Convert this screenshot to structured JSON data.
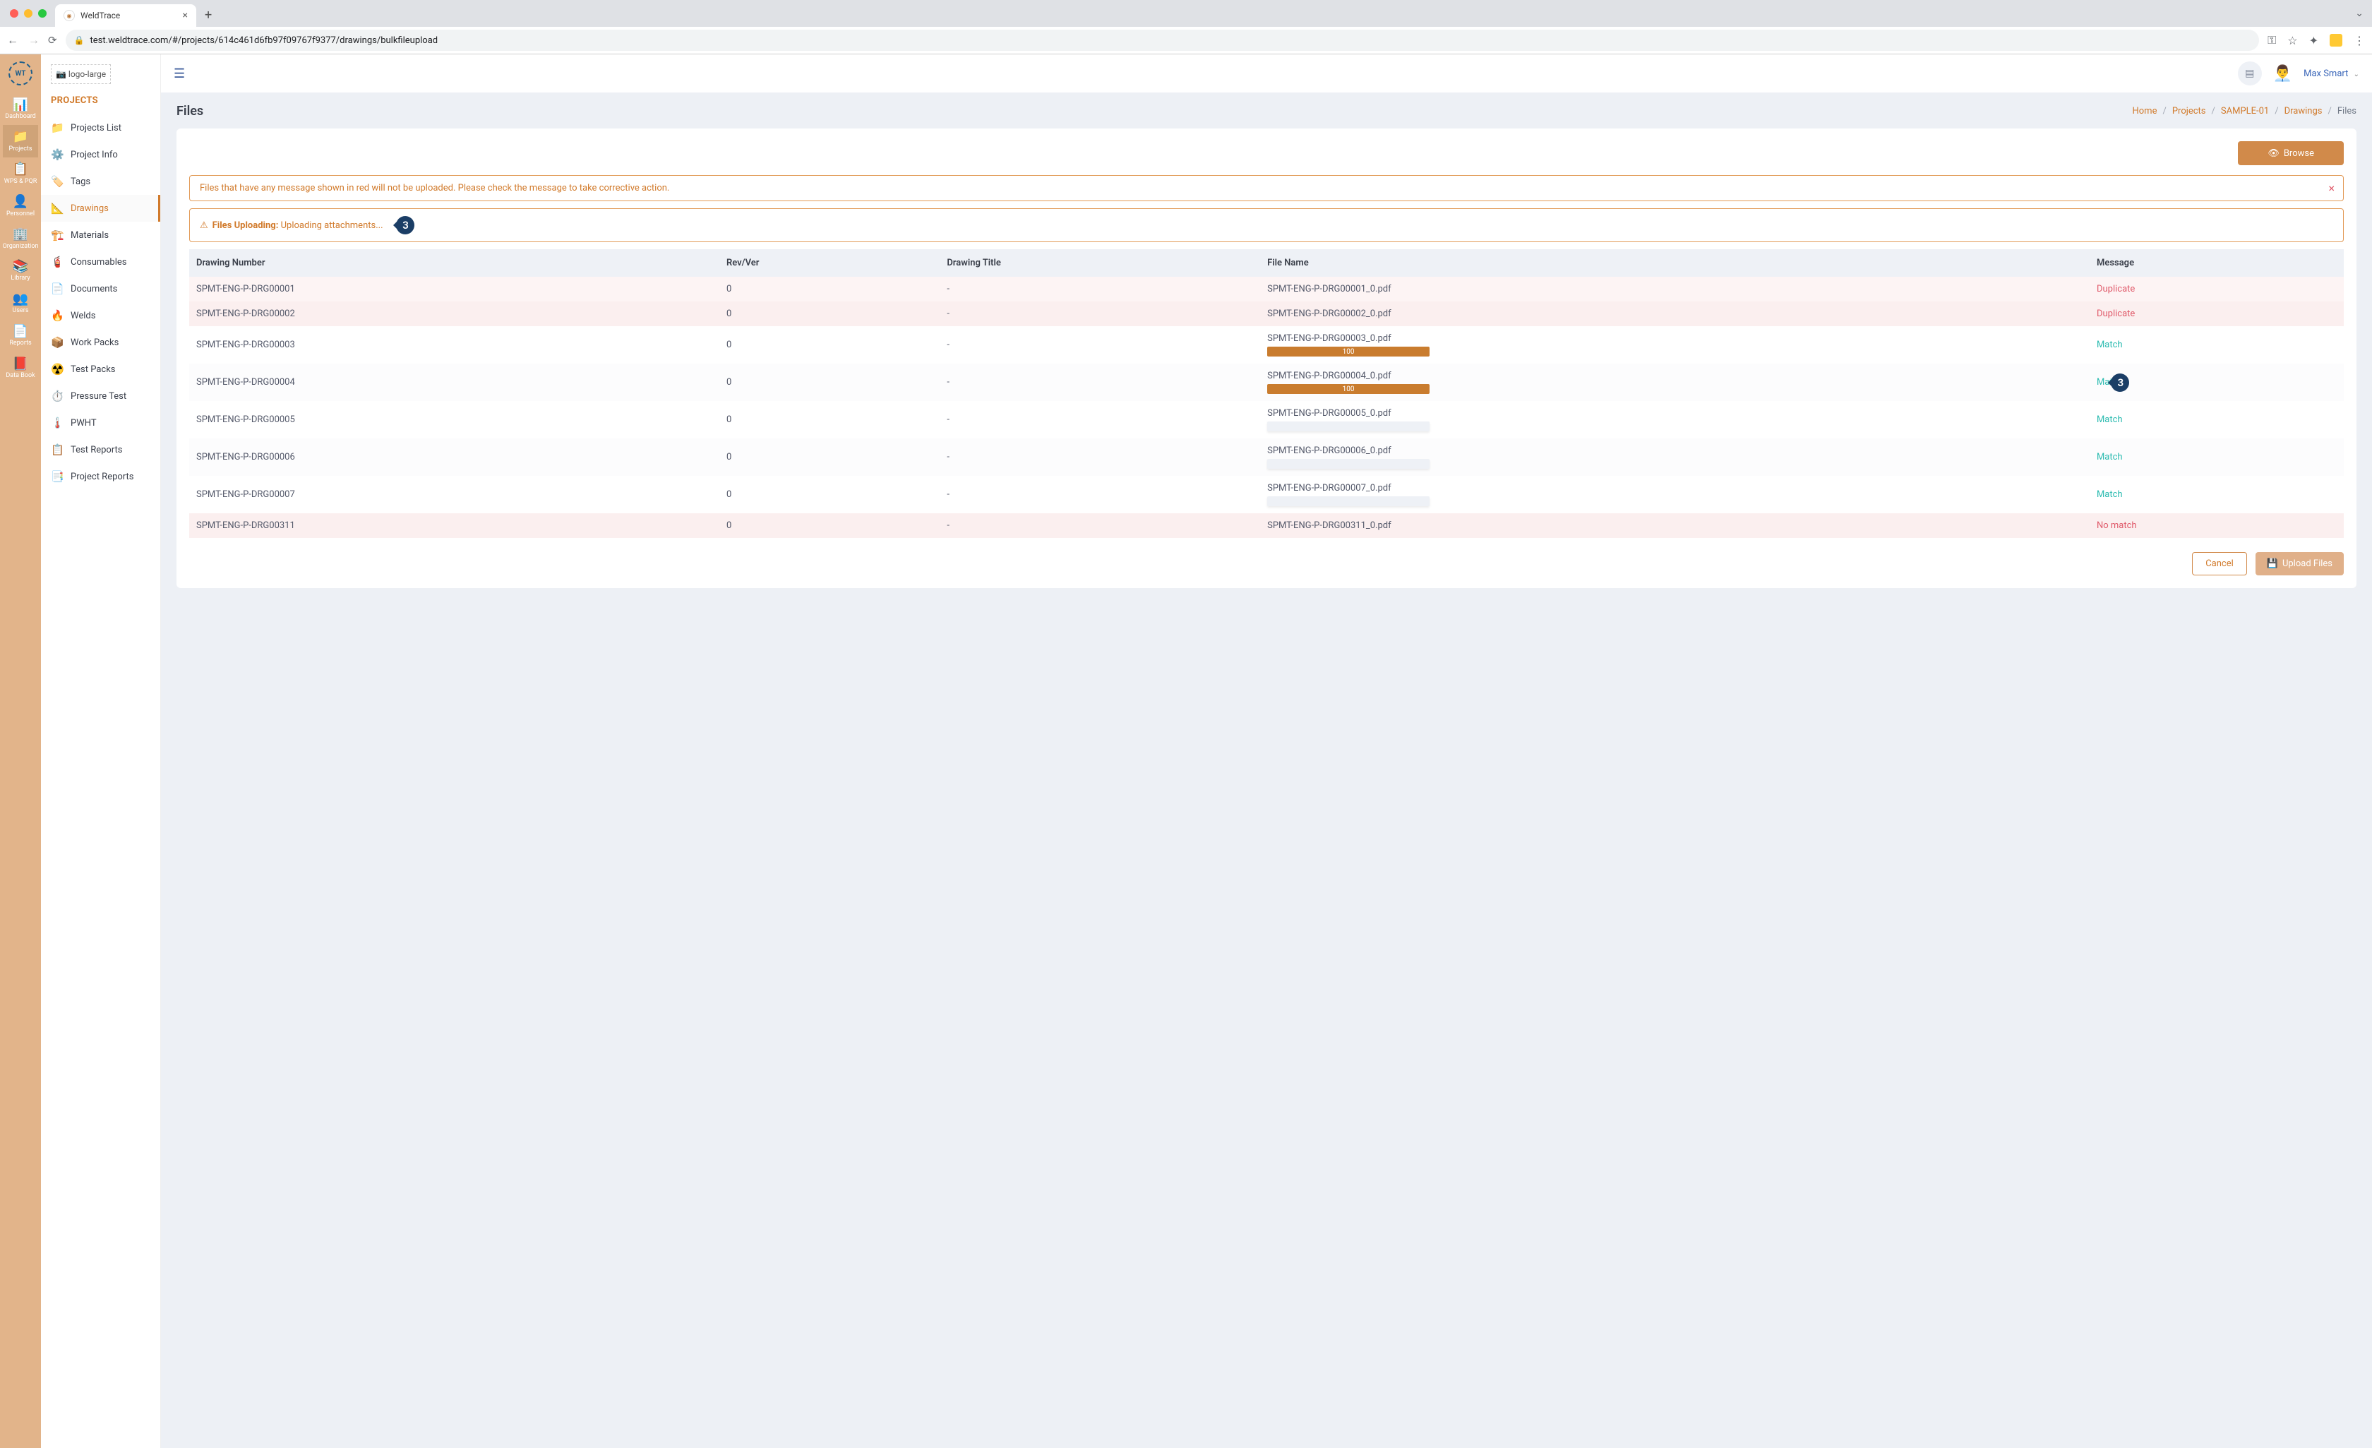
{
  "browser": {
    "tab_title": "WeldTrace",
    "url": "test.weldtrace.com/#/projects/614c461d6fb97f09767f9377/drawings/bulkfileupload"
  },
  "rail": {
    "items": [
      {
        "label": "Dashboard",
        "icon": "📊"
      },
      {
        "label": "Projects",
        "icon": "📁"
      },
      {
        "label": "WPS & PQR",
        "icon": "📋"
      },
      {
        "label": "Personnel",
        "icon": "👤"
      },
      {
        "label": "Organization",
        "icon": "🏢"
      },
      {
        "label": "Library",
        "icon": "📚"
      },
      {
        "label": "Users",
        "icon": "👥"
      },
      {
        "label": "Reports",
        "icon": "📄"
      },
      {
        "label": "Data Book",
        "icon": "📕"
      }
    ]
  },
  "submenu": {
    "logo_alt": "logo-large",
    "heading": "PROJECTS",
    "items": [
      {
        "label": "Projects List",
        "icon": "📁"
      },
      {
        "label": "Project Info",
        "icon": "⚙️"
      },
      {
        "label": "Tags",
        "icon": "🏷️"
      },
      {
        "label": "Drawings",
        "icon": "📐"
      },
      {
        "label": "Materials",
        "icon": "🏗️"
      },
      {
        "label": "Consumables",
        "icon": "🧯"
      },
      {
        "label": "Documents",
        "icon": "📄"
      },
      {
        "label": "Welds",
        "icon": "🔥"
      },
      {
        "label": "Work Packs",
        "icon": "📦"
      },
      {
        "label": "Test Packs",
        "icon": "☢️"
      },
      {
        "label": "Pressure Test",
        "icon": "⏱️"
      },
      {
        "label": "PWHT",
        "icon": "🌡️"
      },
      {
        "label": "Test Reports",
        "icon": "📋"
      },
      {
        "label": "Project Reports",
        "icon": "📑"
      }
    ]
  },
  "header": {
    "user_name": "Max Smart"
  },
  "page": {
    "title": "Files",
    "breadcrumb": {
      "home": "Home",
      "projects": "Projects",
      "project": "SAMPLE-01",
      "drawings": "Drawings",
      "current": "Files"
    },
    "browse_label": "Browse",
    "alert_warning": "Files that have any message shown in red will not be uploaded. Please check the message to take corrective action.",
    "alert_uploading_prefix": "Files Uploading:",
    "alert_uploading_text": "Uploading attachments...",
    "callout_1": "3",
    "callout_2": "3",
    "table": {
      "headers": {
        "drawing_number": "Drawing Number",
        "rev": "Rev/Ver",
        "title": "Drawing Title",
        "file": "File Name",
        "message": "Message"
      },
      "rows": [
        {
          "num": "SPMT-ENG-P-DRG00001",
          "rev": "0",
          "title": "-",
          "file": "SPMT-ENG-P-DRG00001_0.pdf",
          "msg": "Duplicate",
          "msg_type": "dup",
          "progress": null
        },
        {
          "num": "SPMT-ENG-P-DRG00002",
          "rev": "0",
          "title": "-",
          "file": "SPMT-ENG-P-DRG00002_0.pdf",
          "msg": "Duplicate",
          "msg_type": "dup",
          "progress": null
        },
        {
          "num": "SPMT-ENG-P-DRG00003",
          "rev": "0",
          "title": "-",
          "file": "SPMT-ENG-P-DRG00003_0.pdf",
          "msg": "Match",
          "msg_type": "match",
          "progress": 100
        },
        {
          "num": "SPMT-ENG-P-DRG00004",
          "rev": "0",
          "title": "-",
          "file": "SPMT-ENG-P-DRG00004_0.pdf",
          "msg": "Match",
          "msg_type": "match",
          "progress": 100,
          "callout": true
        },
        {
          "num": "SPMT-ENG-P-DRG00005",
          "rev": "0",
          "title": "-",
          "file": "SPMT-ENG-P-DRG00005_0.pdf",
          "msg": "Match",
          "msg_type": "match",
          "progress": 0
        },
        {
          "num": "SPMT-ENG-P-DRG00006",
          "rev": "0",
          "title": "-",
          "file": "SPMT-ENG-P-DRG00006_0.pdf",
          "msg": "Match",
          "msg_type": "match",
          "progress": 0
        },
        {
          "num": "SPMT-ENG-P-DRG00007",
          "rev": "0",
          "title": "-",
          "file": "SPMT-ENG-P-DRG00007_0.pdf",
          "msg": "Match",
          "msg_type": "match",
          "progress": 0
        },
        {
          "num": "SPMT-ENG-P-DRG00311",
          "rev": "0",
          "title": "-",
          "file": "SPMT-ENG-P-DRG00311_0.pdf",
          "msg": "No match",
          "msg_type": "nomatch",
          "progress": null
        }
      ]
    },
    "cancel_label": "Cancel",
    "upload_label": "Upload Files"
  }
}
